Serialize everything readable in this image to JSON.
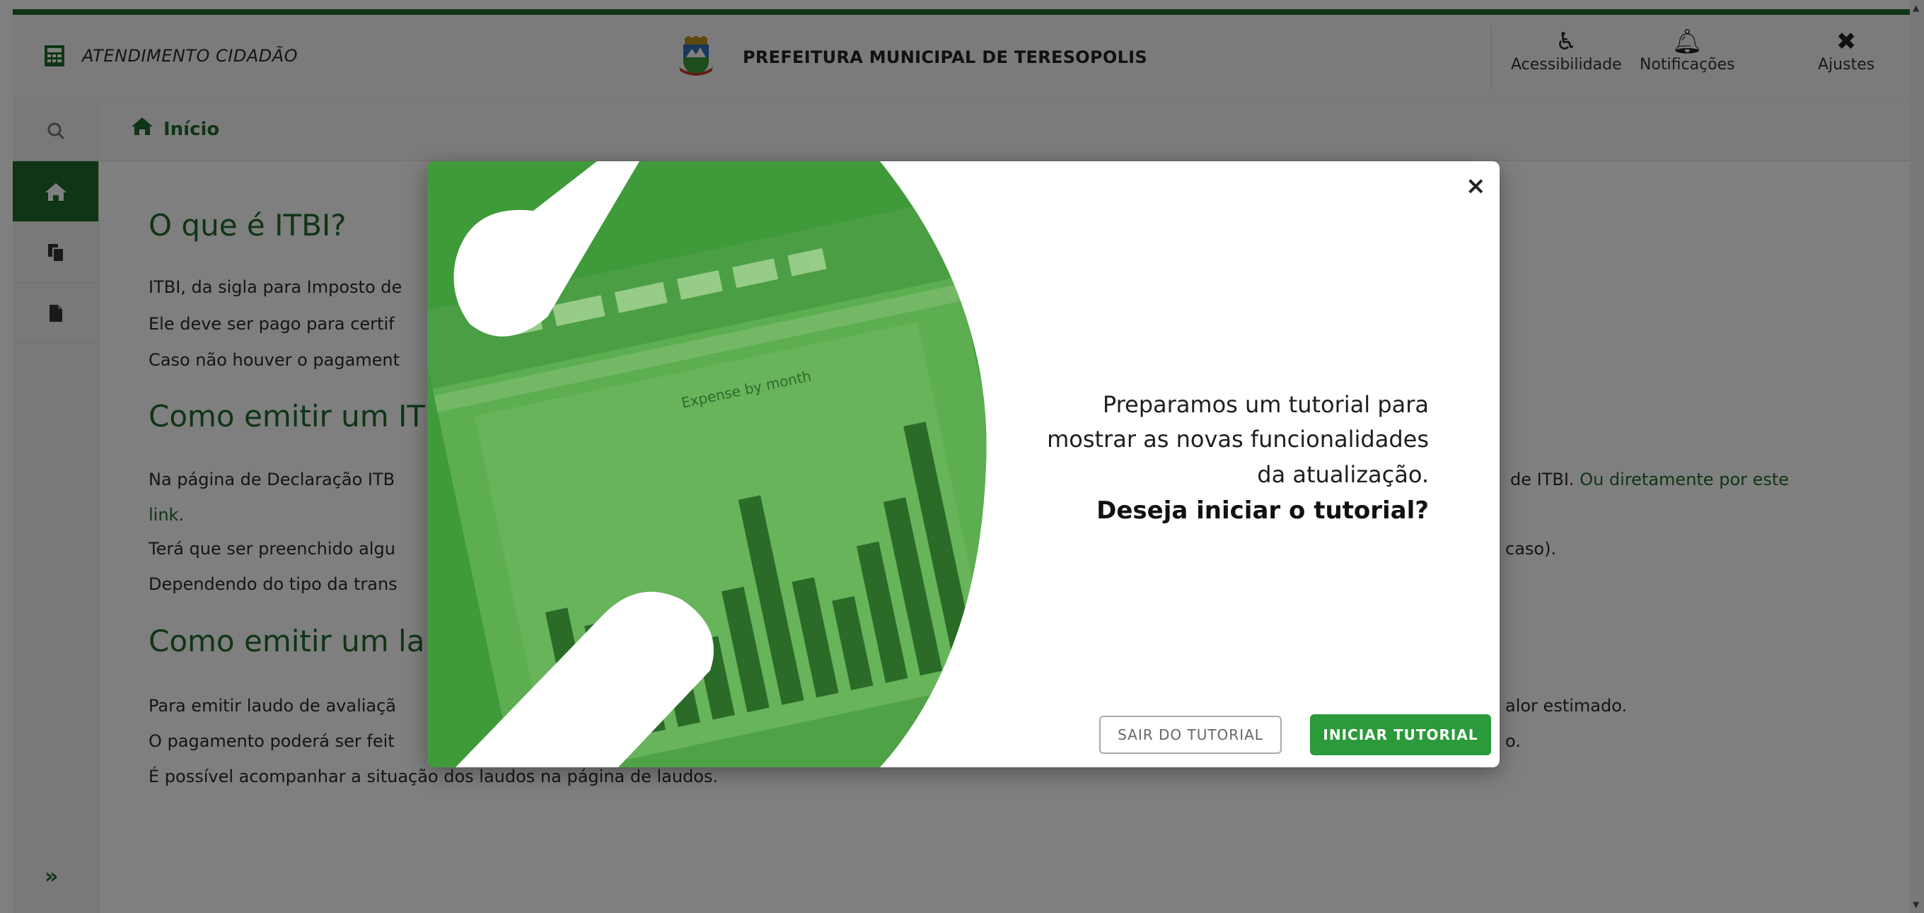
{
  "header": {
    "app_title": "ATENDIMENTO CIDADÃO",
    "org_title": "PREFEITURA MUNICIPAL DE TERESOPOLIS",
    "accessibility_label": "Acessibilidade",
    "notifications_label": "Notificações",
    "settings_label": "Ajustes"
  },
  "breadcrumb": {
    "label": "Início"
  },
  "sidebar": {
    "items": [
      {
        "icon": "search-icon"
      },
      {
        "icon": "home-icon",
        "active": true
      },
      {
        "icon": "files-icon"
      },
      {
        "icon": "document-icon"
      }
    ],
    "expand_label": "»"
  },
  "content": {
    "heading1": "O que é ITBI?",
    "p1": "ITBI, da sigla para Imposto de",
    "p2": "Ele deve ser pago para certif",
    "p3": "Caso não houver o pagament",
    "heading2": "Como emitir um ITE",
    "p4a": "Na página de Declaração ITB",
    "p4b": "de ITBI.",
    "p4_link": "Ou diretamente por este",
    "p4_link2": "link.",
    "p5a": "Terá que ser preenchido algu",
    "p5b": "caso).",
    "p6": "Dependendo do tipo da trans",
    "heading3": "Como emitir um lau",
    "p7a": "Para emitir laudo de avaliaçã",
    "p7b": "alor estimado.",
    "p8a": "O pagamento poderá ser feit",
    "p8b": "o.",
    "p9": "É possível acompanhar a situação dos laudos na página de laudos."
  },
  "modal": {
    "close_label": "×",
    "message_line1": "Preparamos um tutorial para",
    "message_line2": "mostrar as novas funcionalidades",
    "message_line3": "da atualização.",
    "question": "Deseja iniciar o tutorial?",
    "exit_button": "SAIR DO TUTORIAL",
    "start_button": "INICIAR TUTORIAL",
    "chart_title": "Expense by month",
    "bar_levels": [
      0.52,
      0.44,
      0.3,
      0.4,
      0.3,
      0.46,
      0.78,
      0.44,
      0.34,
      0.52,
      0.66,
      0.92
    ]
  },
  "colors": {
    "brand_green": "#1f6b2c",
    "button_green": "#2a9a3a",
    "overlay": "rgba(0,0,0,0.5)"
  }
}
